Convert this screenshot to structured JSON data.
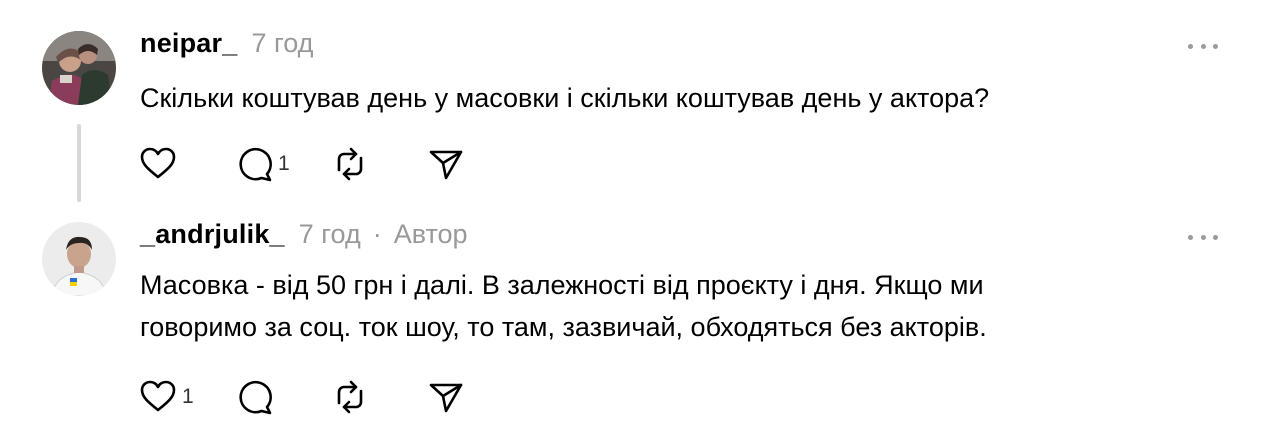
{
  "posts": [
    {
      "username": "neipar_",
      "time": "7 год",
      "text": "Скільки коштував день у масовки і скільки коштував день у актора?",
      "likes": "",
      "replies": "1",
      "icons": [
        "heart-icon",
        "comment-icon",
        "repost-icon",
        "share-icon",
        "more-icon"
      ]
    },
    {
      "username": "_andrjulik_",
      "time": "7 год",
      "separator": "·",
      "author_badge": "Автор",
      "text_line1": "Масовка - від 50 грн і далі. В залежності від проєкту і дня. Якщо ми",
      "text_line2": "говоримо за соц. ток шоу, то там, зазвичай, обходяться без акторів.",
      "likes": "1",
      "replies": "",
      "icons": [
        "heart-icon",
        "comment-icon",
        "repost-icon",
        "share-icon",
        "more-icon"
      ]
    }
  ],
  "colors": {
    "text": "#000000",
    "secondary": "#999999",
    "icon": "#000000",
    "thread_line": "#d8d8d8"
  }
}
